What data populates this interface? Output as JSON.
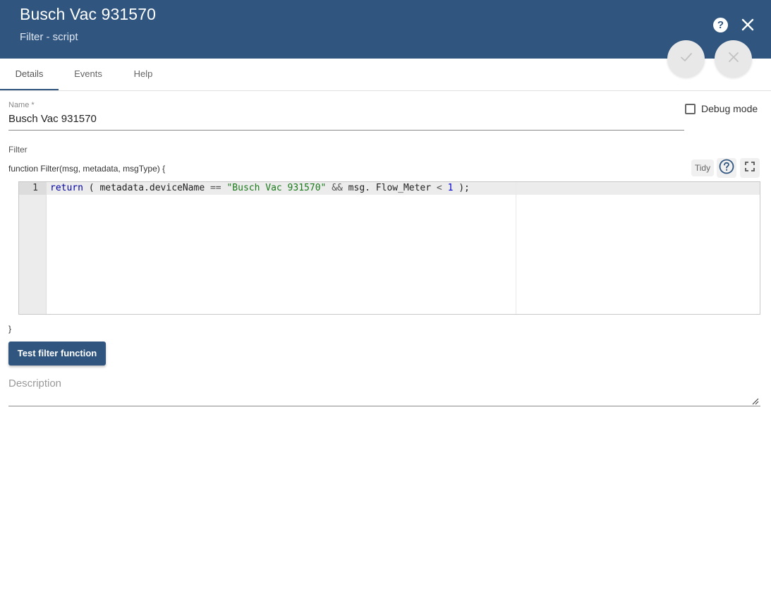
{
  "header": {
    "title": "Busch Vac 931570",
    "subtitle": "Filter - script",
    "help_glyph": "?",
    "colors": {
      "bg": "#305680",
      "text": "#ffffff"
    }
  },
  "fab": {
    "apply_icon": "check-icon",
    "cancel_icon": "close-icon"
  },
  "tabs": [
    {
      "label": "Details",
      "active": true
    },
    {
      "label": "Events",
      "active": false
    },
    {
      "label": "Help",
      "active": false
    }
  ],
  "form": {
    "name_label": "Name *",
    "name_value": "Busch Vac 931570",
    "debug_label": "Debug mode",
    "debug_checked": false,
    "filter_label": "Filter",
    "function_signature": "function Filter(msg, metadata, msgType) {",
    "closing_brace": "}",
    "tidy_label": "Tidy",
    "test_button": "Test filter function",
    "description_placeholder": "Description"
  },
  "editor": {
    "line_number": "1",
    "code": {
      "kw_return": "return",
      "t1": " ( metadata.deviceName ",
      "op_eq": "==",
      "t2": " ",
      "str": "\"Busch Vac 931570\"",
      "t3": " ",
      "op_and": "&&",
      "t4": " msg. Flow_Meter ",
      "op_lt": "<",
      "t5": " ",
      "num": "1",
      "t6": " );"
    }
  }
}
